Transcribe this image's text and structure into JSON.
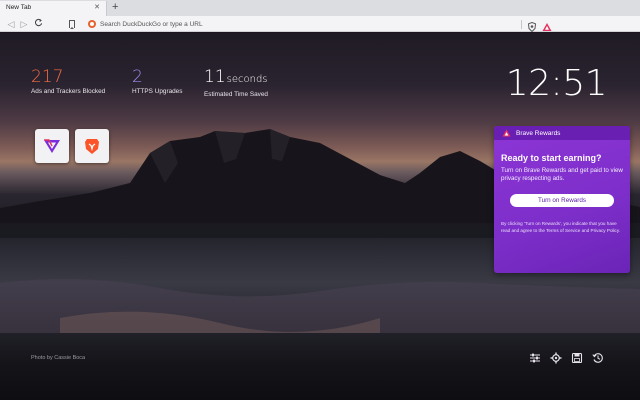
{
  "tab": {
    "title": "New Tab"
  },
  "toolbar": {
    "url_placeholder": "Search DuckDuckGo or type a URL"
  },
  "stats": [
    {
      "value": "217",
      "unit": "",
      "label": "Ads and Trackers Blocked",
      "color": "#f66d44"
    },
    {
      "value": "2",
      "unit": "",
      "label": "HTTPS Upgrades",
      "color": "#a28bf0"
    },
    {
      "value": "11",
      "unit": "seconds",
      "label": "Estimated Time Saved",
      "color": "#ffffff"
    }
  ],
  "clock": {
    "time": "12:51"
  },
  "top_sites": [
    {
      "icon": "brave-rewards-triangle-icon"
    },
    {
      "icon": "brave-lion-icon"
    }
  ],
  "rewards": {
    "title": "Brave Rewards",
    "heading": "Ready to start earning?",
    "description": "Turn on Brave Rewards and get paid to view privacy respecting ads.",
    "button_label": "Turn on Rewards",
    "terms": "By clicking 'Turn on Rewards', you indicate that you have read and agree to the Terms of Service and Privacy Policy."
  },
  "photo_credit": "Photo by Cassie Boca",
  "bottom_icons": [
    "customize-icon",
    "settings-icon",
    "bookmarks-icon",
    "history-icon"
  ],
  "colors": {
    "rewards_purple": "#7d2ec9",
    "brave_orange": "#fb542b",
    "stat_orange": "#f66d44",
    "stat_purple": "#a28bf0"
  }
}
